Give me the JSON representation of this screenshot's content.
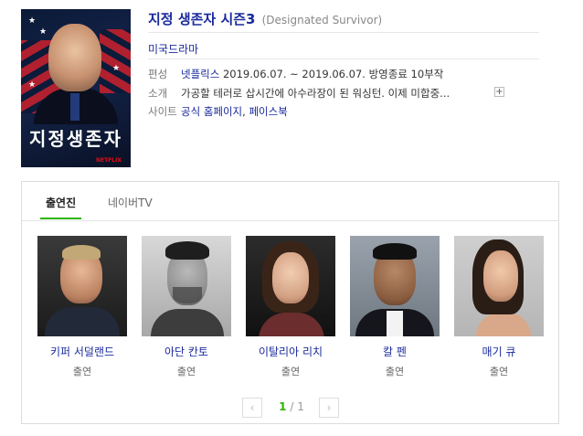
{
  "show": {
    "title": "지정 생존자 시즌3",
    "original_title": "(Designated Survivor)",
    "genre": "미국드라마"
  },
  "poster": {
    "title_text": "지정생존자",
    "brand": "NETFLIX"
  },
  "info": {
    "schedule_label": "편성",
    "network": "넷플릭스",
    "schedule_detail": " 2019.06.07. ~ 2019.06.07. 방영종료 10부작",
    "summary_label": "소개",
    "summary": "가공할 테러로 삽시간에 아수라장이 된 워싱턴. 이제 미합중...",
    "expand_label": "+",
    "site_label": "사이트",
    "site_links": [
      "공식 홈페이지",
      "페이스북"
    ],
    "site_separator": ", "
  },
  "tabs": [
    "출연진",
    "네이버TV"
  ],
  "cast": [
    {
      "name": "키퍼 서덜랜드",
      "role": "출연"
    },
    {
      "name": "아단 칸토",
      "role": "출연"
    },
    {
      "name": "이탈리아 리치",
      "role": "출연"
    },
    {
      "name": "칼 펜",
      "role": "출연"
    },
    {
      "name": "매기 큐",
      "role": "출연"
    }
  ],
  "pagination": {
    "prev": "‹",
    "next": "›",
    "current": "1",
    "separator": " / ",
    "total": "1"
  }
}
